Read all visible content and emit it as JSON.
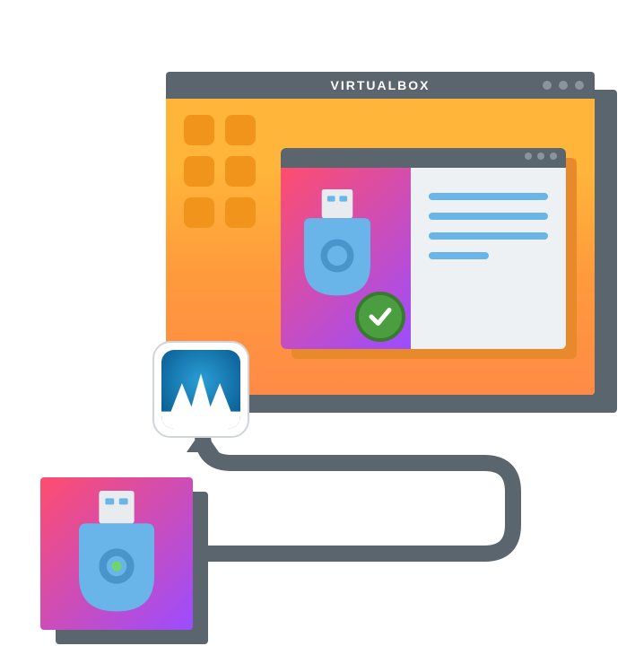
{
  "window": {
    "title": "VIRTUALBOX"
  },
  "icons": {
    "usb": "usb-icon",
    "checkmark": "checkmark-icon",
    "vm_logo": "virtualbox-logo-icon",
    "arrow": "pipe-arrow-icon"
  },
  "colors": {
    "titlebar": "#5b656d",
    "accent_blue": "#69b4e8",
    "check_green": "#4b9e3f"
  }
}
